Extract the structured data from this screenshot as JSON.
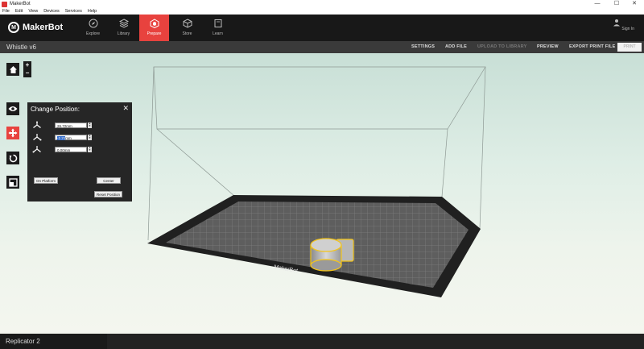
{
  "window": {
    "title": "MakerBot",
    "minimize": "—",
    "maximize": "☐",
    "close": "✕"
  },
  "menu": [
    "File",
    "Edit",
    "View",
    "Devices",
    "Services",
    "Help"
  ],
  "nav": {
    "logo": "MakerBot",
    "tabs": [
      {
        "label": "Explore",
        "icon": "compass-icon"
      },
      {
        "label": "Library",
        "icon": "library-icon"
      },
      {
        "label": "Prepare",
        "icon": "prepare-icon"
      },
      {
        "label": "Store",
        "icon": "cube-icon"
      },
      {
        "label": "Learn",
        "icon": "book-icon"
      }
    ],
    "signin": "Sign In"
  },
  "toolbar": {
    "project_name": "Whistle v6",
    "settings": "SETTINGS",
    "add_file": "ADD FILE",
    "upload": "UPLOAD TO LIBRARY",
    "preview": "PREVIEW",
    "export": "EXPORT PRINT FILE",
    "print": "PRINT"
  },
  "view_controls": {
    "zoom_in": "+",
    "zoom_out": "−"
  },
  "panel": {
    "title": "Change Position:",
    "close": "✕",
    "x_value": "26.72mm",
    "y_value": "-2.21",
    "y_unit": "mm",
    "z_value": "0.00mm",
    "on_platform": "On Platform",
    "center": "Center",
    "reset": "Reset Position"
  },
  "status": {
    "machine": "Replicator 2"
  },
  "colors": {
    "accent": "#e8423e",
    "selection": "#f5c518"
  }
}
